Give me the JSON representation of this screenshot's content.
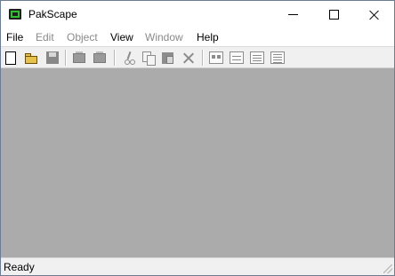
{
  "window": {
    "title": "PakScape"
  },
  "menubar": {
    "items": [
      {
        "label": "File",
        "enabled": true
      },
      {
        "label": "Edit",
        "enabled": false
      },
      {
        "label": "Object",
        "enabled": false
      },
      {
        "label": "View",
        "enabled": true
      },
      {
        "label": "Window",
        "enabled": false
      },
      {
        "label": "Help",
        "enabled": true
      }
    ]
  },
  "toolbar": {
    "buttons": [
      {
        "name": "new-icon",
        "enabled": true
      },
      {
        "name": "open-folder-icon",
        "enabled": true
      },
      {
        "name": "save-icon",
        "enabled": false
      },
      {
        "name": "extract-icon",
        "enabled": false
      },
      {
        "name": "add-file-icon",
        "enabled": false
      },
      {
        "name": "cut-icon",
        "enabled": false
      },
      {
        "name": "copy-icon",
        "enabled": false
      },
      {
        "name": "paste-icon",
        "enabled": false
      },
      {
        "name": "delete-icon",
        "enabled": false
      },
      {
        "name": "large-icons-view-icon",
        "enabled": false
      },
      {
        "name": "small-icons-view-icon",
        "enabled": false
      },
      {
        "name": "list-view-icon",
        "enabled": false
      },
      {
        "name": "details-view-icon",
        "enabled": false
      }
    ]
  },
  "statusbar": {
    "text": "Ready"
  },
  "colors": {
    "workspace": "#ababab",
    "title_bg": "#ffffff",
    "disabled_text": "#8a8a8a"
  }
}
